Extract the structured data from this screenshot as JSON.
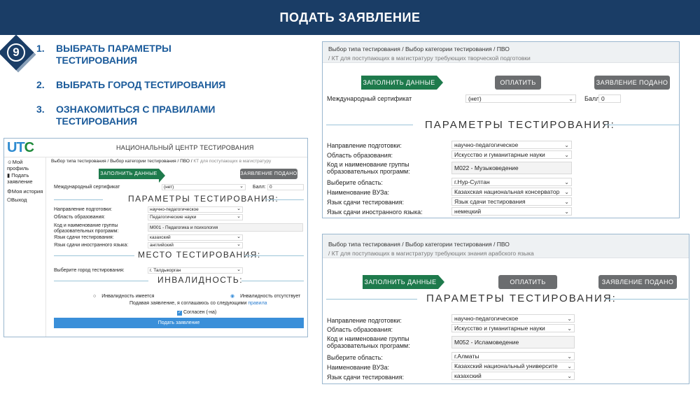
{
  "header": {
    "title": "ПОДАТЬ ЗАЯВЛЕНИЕ"
  },
  "step_badge": "9",
  "steps": [
    {
      "num": "1.",
      "text": "ВЫБРАТЬ ПАРАМЕТРЫ ТЕСТИРОВАНИЯ"
    },
    {
      "num": "2.",
      "text": "ВЫБРАТЬ ГОРОД ТЕСТИРОВАНИЯ"
    },
    {
      "num": "3.",
      "text": "ОЗНАКОМИТЬСЯ С ПРАВИЛАМИ ТЕСТИРОВАНИЯ"
    }
  ],
  "left": {
    "logo_u": "UT",
    "logo_o": "C",
    "site_title": "НАЦИОНАЛЬНЫЙ ЦЕНТР ТЕСТИРОВАНИЯ",
    "sidebar": [
      "Мой профиль",
      "Подать заявление",
      "Моя история",
      "Выход"
    ],
    "breadcrumb_main": "Выбор типа тестирования / Выбор категории тестирования / ПВО /",
    "breadcrumb_sub": "КТ для поступающих в магистратуру",
    "btn_fill": "ЗАПОЛНИТЬ ДАННЫЕ",
    "btn_submitted": "ЗАЯВЛЕНИЕ ПОДАНО",
    "cert_label": "Международный сертификат",
    "cert_value": "(нет)",
    "score_label": "Балл:",
    "score_value": "0",
    "params_title": "ПАРАМЕТРЫ ТЕСТИРОВАНИЯ:",
    "fields": [
      {
        "label": "Направление подготовки:",
        "value": "научно-педагогическое"
      },
      {
        "label": "Область образования:",
        "value": "Педагогические науки"
      },
      {
        "label": "Код и наименование группы образовательных программ:",
        "value": "M001 - Педагогика и психология"
      },
      {
        "label": "Язык сдачи тестирования:",
        "value": "казахский"
      },
      {
        "label": "Язык сдачи иностранного языка:",
        "value": "английский"
      }
    ],
    "place_title": "МЕСТО ТЕСТИРОВАНИЯ:",
    "city_label": "Выберите город тестирования:",
    "city_value": "г. Талдыкорган",
    "disability_title": "ИНВАЛИДНОСТЬ:",
    "disability_yes": "Инвалидность имеется",
    "disability_no": "Инвалидность отсутствует",
    "agree_text": "Подавая заявление, я соглашаюсь со следующими",
    "agree_link": "правила",
    "agree_check": "Согласен (-на)",
    "submit_btn": "Подать заявление"
  },
  "top_right": {
    "breadcrumb_main": "Выбор типа тестирования / Выбор категории тестирования / ПВО",
    "breadcrumb_sub": "/ КТ для поступающих в магистратуру требующих творческой подготовки",
    "btn_fill": "ЗАПОЛНИТЬ ДАННЫЕ",
    "btn_pay": "ОПЛАТИТЬ",
    "btn_submitted": "ЗАЯВЛЕНИЕ ПОДАНО",
    "cert_label": "Международный сертификат",
    "cert_value": "(нет)",
    "score_label": "Балл:",
    "score_value": "0",
    "params_title": "ПАРАМЕТРЫ ТЕСТИРОВАНИЯ:",
    "fields": [
      {
        "label": "Направление подготовки:",
        "value": "научно-педагогическое"
      },
      {
        "label": "Область образования:",
        "value": "Искусство и гуманитарные науки"
      },
      {
        "label": "Код и наименование группы образовательных программ:",
        "value": "M022 - Музыковедение"
      },
      {
        "label": "Выберите область:",
        "value": "г.Нур-Султан"
      },
      {
        "label": "Наименование ВУЗа:",
        "value": "Казахская национальная консерватор"
      },
      {
        "label": "Язык сдачи тестирования:",
        "value": "Язык сдачи тестирования"
      },
      {
        "label": "Язык сдачи иностранного языка:",
        "value": "немецкий"
      }
    ]
  },
  "bottom_right": {
    "breadcrumb_main": "Выбор типа тестирования / Выбор категории тестирования / ПВО",
    "breadcrumb_sub": "/ КТ для поступающих в магистратуру требующих знания арабского языка",
    "btn_fill": "ЗАПОЛНИТЬ ДАННЫЕ",
    "btn_pay": "ОПЛАТИТЬ",
    "btn_submitted": "ЗАЯВЛЕНИЕ ПОДАНО",
    "params_title": "ПАРАМЕТРЫ ТЕСТИРОВАНИЯ:",
    "fields": [
      {
        "label": "Направление подготовки:",
        "value": "научно-педагогическое"
      },
      {
        "label": "Область образования:",
        "value": "Искусство и гуманитарные науки"
      },
      {
        "label": "Код и наименование группы образовательных программ:",
        "value": "M052 - Исламоведение"
      },
      {
        "label": "Выберите область:",
        "value": "г.Алматы"
      },
      {
        "label": "Наименование ВУЗа:",
        "value": "Казахский национальный университе"
      },
      {
        "label": "Язык сдачи тестирования:",
        "value": "казахский"
      }
    ]
  },
  "colors": {
    "header_bg": "#1a3d66",
    "step_text": "#1a5a9a",
    "green_btn": "#1e7a4c",
    "gray_btn": "#6b6d6f",
    "blue_btn": "#3a8fd9"
  }
}
